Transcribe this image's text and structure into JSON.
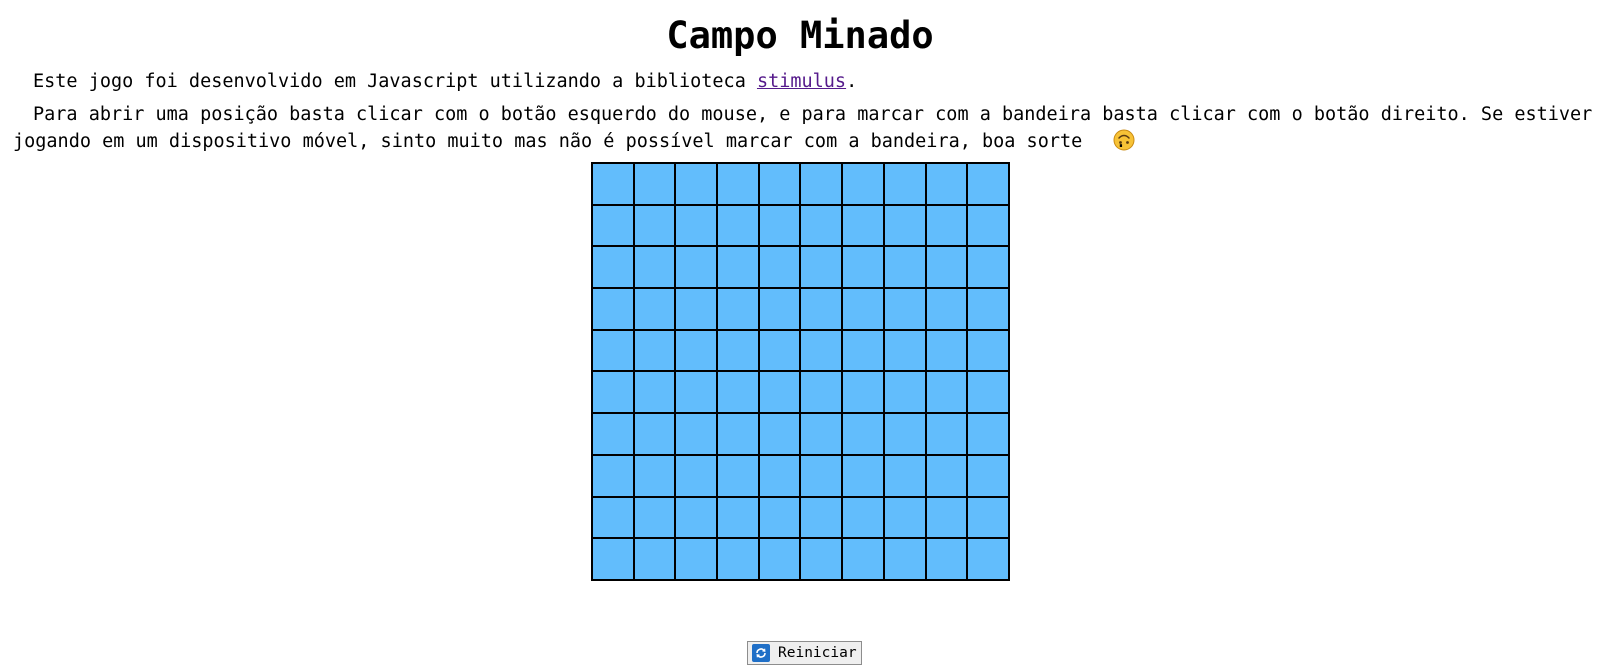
{
  "page": {
    "title": "Campo Minado"
  },
  "intro": {
    "text_before_link": "Este jogo foi desenvolvido em Javascript utilizando a biblioteca ",
    "link_label": "stimulus",
    "text_after_link": "."
  },
  "instructions": {
    "text": "Para abrir uma posição basta clicar com o botão esquerdo do mouse, e para marcar com a bandeira basta clicar com o botão direito. Se estiver jogando em um dispositivo móvel, sinto muito mas não é possível marcar com a bandeira, boa sorte ",
    "emoji_icon": "upside-down-face-icon",
    "text_end": "."
  },
  "board": {
    "rows": 10,
    "columns": 10,
    "cell_color": "#62bdfc",
    "state": "all-closed"
  },
  "controls": {
    "restart_label": "Reiniciar",
    "restart_icon": "refresh-icon"
  }
}
